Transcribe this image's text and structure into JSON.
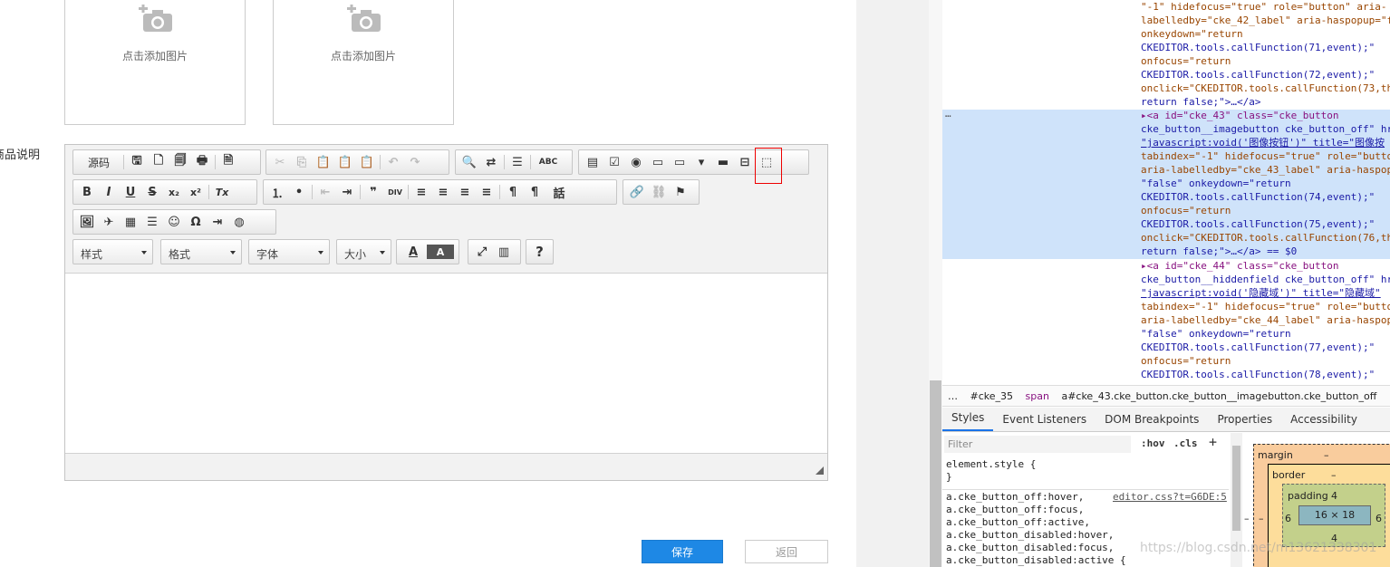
{
  "upload": {
    "label": "点击添加图片"
  },
  "desc_label": "商品说明",
  "editor": {
    "row1": {
      "source_label": "源码"
    },
    "combos": {
      "style": "样式",
      "format": "格式",
      "font": "字体",
      "size": "大小"
    },
    "glyphs": {
      "save": "🖫",
      "new": "🗋",
      "preview": "🗐",
      "print": "🖶",
      "templates": "🗎",
      "cut": "✂",
      "copy": "⎘",
      "paste": "📋",
      "paste_text": "📋",
      "paste_word": "📋",
      "undo": "↶",
      "redo": "↷",
      "find": "🔍",
      "replace": "⇄",
      "select_all": "☰",
      "spell": "ABC",
      "form": "▤",
      "checkbox": "☑",
      "radio": "◉",
      "textfield": "▭",
      "textarea": "▭",
      "select": "▾",
      "button": "▬",
      "imagebutton": "⊟",
      "hiddenfield": "⬚",
      "bold": "B",
      "italic": "I",
      "underline": "U",
      "strike": "S",
      "subscript": "x₂",
      "superscript": "x²",
      "removeformat": "Tx",
      "numbered": "⒈",
      "bulleted": "•",
      "outdent": "⇤",
      "indent": "⇥",
      "blockquote": "❞",
      "div": "DIV",
      "align_left": "≡",
      "align_center": "≡",
      "align_right": "≡",
      "justify": "≡",
      "ltr": "¶",
      "rtl": "¶",
      "language": "話",
      "link": "🔗",
      "unlink": "⛓",
      "anchor": "⚑",
      "image": "🖼",
      "flash": "✈",
      "table": "▦",
      "hr": "☰",
      "smiley": "☺",
      "specialchar": "Ω",
      "pagebreak": "⇥",
      "iframe": "◍",
      "textcolor": "A",
      "bgcolor": "A",
      "maximize": "⤢",
      "showblocks": "▥",
      "about": "?"
    }
  },
  "buttons": {
    "save": "保存",
    "back": "返回"
  },
  "devtools": {
    "dom_lines": [
      {
        "cls": "at",
        "text": "\"-1\" hidefocus=\"true\" role=\"button\" aria-"
      },
      {
        "cls": "at",
        "text": "labelledby=\"cke_42_label\" aria-haspopup=\"f"
      },
      {
        "cls": "at",
        "text": "onkeydown=\"return"
      },
      {
        "cls": "av",
        "text": "CKEDITOR.tools.callFunction(71,event);\""
      },
      {
        "cls": "at",
        "text": "onfocus=\"return"
      },
      {
        "cls": "av",
        "text": "CKEDITOR.tools.callFunction(72,event);\""
      },
      {
        "cls": "at",
        "text": "onclick=\"CKEDITOR.tools.callFunction(73,th"
      },
      {
        "cls": "av",
        "text": "return false;\">…</a>"
      },
      {
        "cls": "tg",
        "text": "▸<a id=\"cke_43\" class=\"cke_button"
      },
      {
        "cls": "av",
        "text": "cke_button__imagebutton cke_button_off\" hr"
      },
      {
        "cls": "lk",
        "text": "\"javascript:void('图像按钮')\" title=\"图像按"
      },
      {
        "cls": "at",
        "text": "tabindex=\"-1\" hidefocus=\"true\" role=\"butto"
      },
      {
        "cls": "at",
        "text": "aria-labelledby=\"cke_43_label\" aria-haspop"
      },
      {
        "cls": "av",
        "text": "\"false\" onkeydown=\"return"
      },
      {
        "cls": "av",
        "text": "CKEDITOR.tools.callFunction(74,event);\""
      },
      {
        "cls": "at",
        "text": "onfocus=\"return"
      },
      {
        "cls": "av",
        "text": "CKEDITOR.tools.callFunction(75,event);\""
      },
      {
        "cls": "at",
        "text": "onclick=\"CKEDITOR.tools.callFunction(76,th"
      },
      {
        "cls": "av",
        "text": "return false;\">…</a> == $0"
      },
      {
        "cls": "tg",
        "text": "▸<a id=\"cke_44\" class=\"cke_button"
      },
      {
        "cls": "av",
        "text": "cke_button__hiddenfield cke_button_off\" hr"
      },
      {
        "cls": "lk",
        "text": "\"javascript:void('隐藏域')\" title=\"隐藏域\""
      },
      {
        "cls": "at",
        "text": "tabindex=\"-1\" hidefocus=\"true\" role=\"butto"
      },
      {
        "cls": "at",
        "text": "aria-labelledby=\"cke_44_label\" aria-haspop"
      },
      {
        "cls": "av",
        "text": "\"false\" onkeydown=\"return"
      },
      {
        "cls": "av",
        "text": "CKEDITOR.tools.callFunction(77,event);\""
      },
      {
        "cls": "at",
        "text": "onfocus=\"return"
      },
      {
        "cls": "av",
        "text": "CKEDITOR.tools.callFunction(78,event);\""
      }
    ],
    "dom_dots": "…",
    "breadcrumbs": [
      "…",
      "#cke_35",
      "span",
      "a#cke_43.cke_button.cke_button__imagebutton.cke_button_off"
    ],
    "tabs": [
      "Styles",
      "Event Listeners",
      "DOM Breakpoints",
      "Properties",
      "Accessibility"
    ],
    "filter_placeholder": "Filter",
    "hov": ":hov",
    "cls": ".cls",
    "plus": "+",
    "style_lines": [
      "element.style {",
      "}"
    ],
    "rule_lines": [
      "a.cke_button_off:hover,",
      "a.cke_button_off:focus,",
      "a.cke_button_off:active,",
      "a.cke_button_disabled:hover,",
      "a.cke_button_disabled:focus,",
      "a.cke_button_disabled:active {"
    ],
    "css_link": "editor.css?t=G6DE:5",
    "boxmodel": {
      "margin": "margin",
      "border": "border",
      "padding": "padding",
      "dash": "–",
      "content": "16 × 18",
      "pad_top": "4",
      "pad_bottom": "4",
      "pad_left": "6",
      "pad_right": "6"
    }
  },
  "watermark": "https://blog.csdn.net/m13621338301"
}
